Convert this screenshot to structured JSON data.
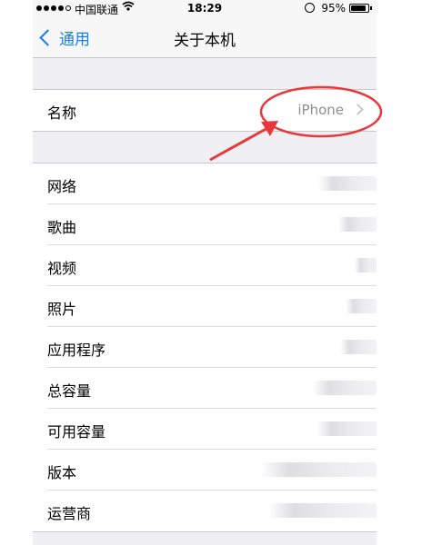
{
  "status_bar": {
    "carrier": "中国联通",
    "time": "18:29",
    "battery": "95%",
    "battery_level": 0.95,
    "signal_bars": 4,
    "signal_total": 5
  },
  "nav": {
    "back_label": "通用",
    "title": "关于本机"
  },
  "name_row": {
    "label": "名称",
    "value": "iPhone"
  },
  "info_rows": [
    {
      "label": "网络"
    },
    {
      "label": "歌曲"
    },
    {
      "label": "视频"
    },
    {
      "label": "照片"
    },
    {
      "label": "应用程序"
    },
    {
      "label": "总容量"
    },
    {
      "label": "可用容量"
    },
    {
      "label": "版本"
    },
    {
      "label": "运营商"
    }
  ],
  "colors": {
    "accent": "#1a7cf6",
    "annotation": "#e8383b",
    "background": "#efeff4"
  }
}
